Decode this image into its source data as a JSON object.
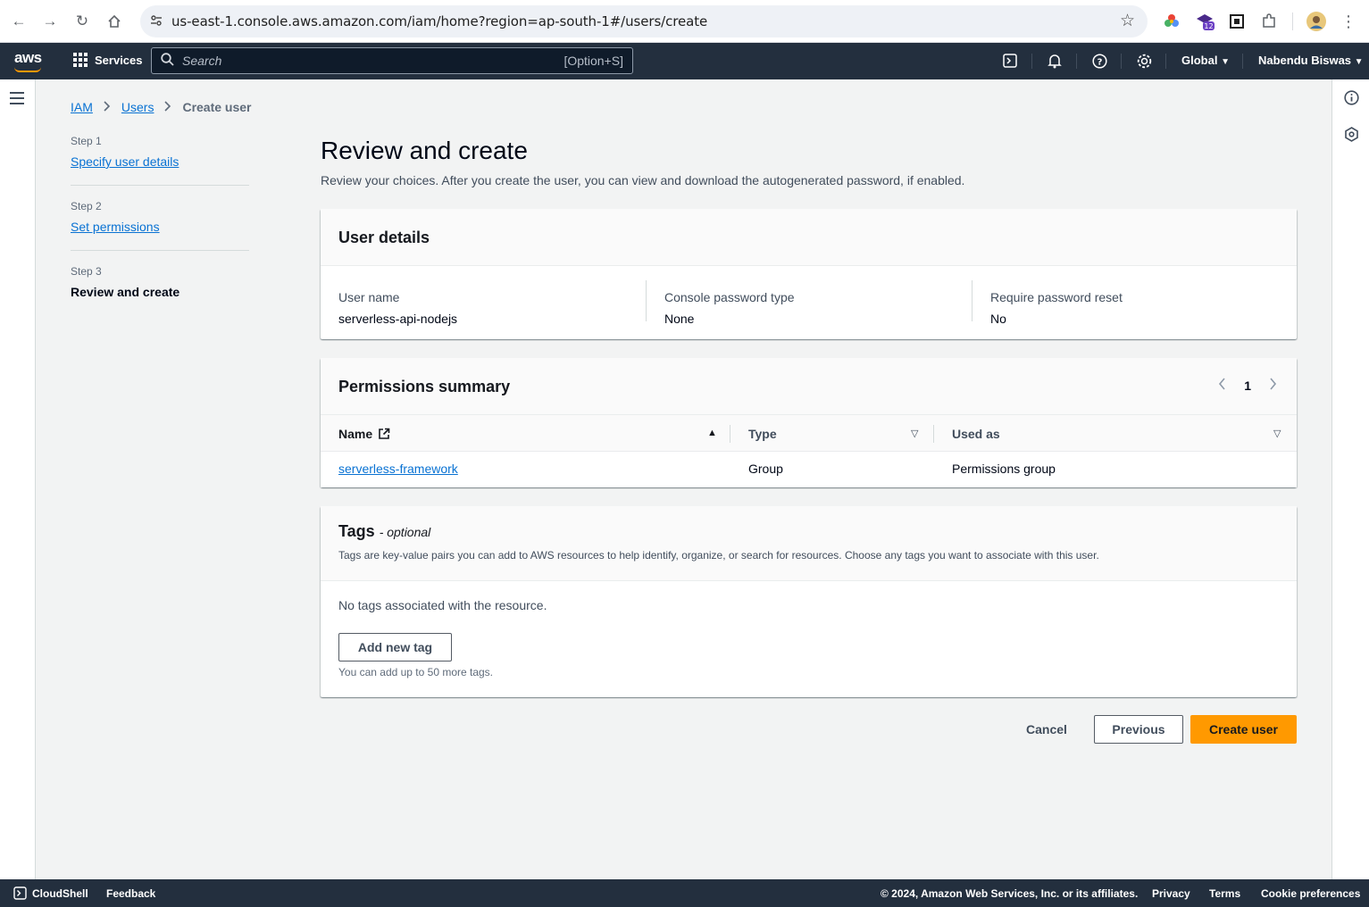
{
  "browser": {
    "url": "us-east-1.console.aws.amazon.com/iam/home?region=ap-south-1#/users/create",
    "extension_badge": "12"
  },
  "aws_nav": {
    "logo": "aws",
    "services_label": "Services",
    "search_placeholder": "Search",
    "search_shortcut": "[Option+S]",
    "region_label": "Global",
    "user_label": "Nabendu Biswas"
  },
  "breadcrumb": {
    "items": [
      "IAM",
      "Users"
    ],
    "current": "Create user"
  },
  "steps": [
    {
      "number": "Step 1",
      "label": "Specify user details"
    },
    {
      "number": "Step 2",
      "label": "Set permissions"
    },
    {
      "number": "Step 3",
      "label": "Review and create"
    }
  ],
  "page": {
    "title": "Review and create",
    "description": "Review your choices. After you create the user, you can view and download the autogenerated password, if enabled."
  },
  "user_details": {
    "title": "User details",
    "fields": [
      {
        "label": "User name",
        "value": "serverless-api-nodejs"
      },
      {
        "label": "Console password type",
        "value": "None"
      },
      {
        "label": "Require password reset",
        "value": "No"
      }
    ]
  },
  "permissions": {
    "title": "Permissions summary",
    "page_number": "1",
    "columns": [
      "Name",
      "Type",
      "Used as"
    ],
    "rows": [
      {
        "name": "serverless-framework",
        "type": "Group",
        "used_as": "Permissions group"
      }
    ]
  },
  "tags": {
    "title": "Tags",
    "optional": "- optional",
    "description": "Tags are key-value pairs you can add to AWS resources to help identify, organize, or search for resources. Choose any tags you want to associate with this user.",
    "empty_text": "No tags associated with the resource.",
    "add_button": "Add new tag",
    "hint": "You can add up to 50 more tags."
  },
  "actions": {
    "cancel": "Cancel",
    "previous": "Previous",
    "create": "Create user"
  },
  "footer": {
    "cloudshell": "CloudShell",
    "feedback": "Feedback",
    "copyright": "© 2024, Amazon Web Services, Inc. or its affiliates.",
    "privacy": "Privacy",
    "terms": "Terms",
    "cookies": "Cookie preferences"
  },
  "colors": {
    "aws_nav_bg": "#232f3e",
    "link": "#0972d3",
    "primary_button": "#ff9900"
  }
}
